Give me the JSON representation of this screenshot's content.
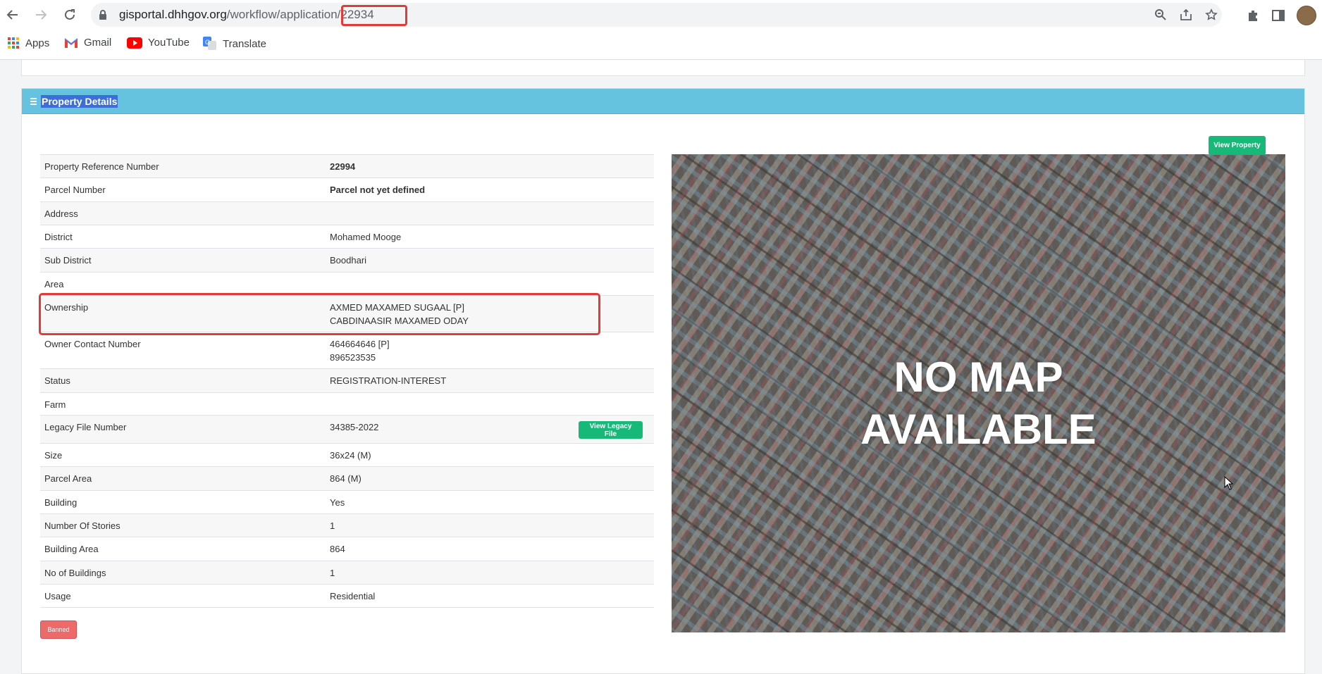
{
  "browser": {
    "url_host": "gisportal.dhhgov.org",
    "url_path": "/workflow/applicatio",
    "url_highlighted": "n/22934",
    "bookmarks": [
      {
        "label": "Apps",
        "icon": "apps-grid-icon"
      },
      {
        "label": "Gmail",
        "icon": "gmail-icon"
      },
      {
        "label": "YouTube",
        "icon": "youtube-icon"
      },
      {
        "label": "Translate",
        "icon": "translate-icon"
      }
    ]
  },
  "panel": {
    "title": "Property Details",
    "view_property_label": "View Property",
    "view_legacy_label": "View Legacy File",
    "banned_label": "Banned",
    "map_text_line1": "NO MAP",
    "map_text_line2": "AVAILABLE"
  },
  "details": [
    {
      "label": "Property Reference Number",
      "value": "22994"
    },
    {
      "label": "Parcel Number",
      "value": "Parcel not yet defined"
    },
    {
      "label": "Address",
      "value": ""
    },
    {
      "label": "District",
      "value": "Mohamed Mooge"
    },
    {
      "label": "Sub District",
      "value": "Boodhari"
    },
    {
      "label": "Area",
      "value": ""
    },
    {
      "label": "Ownership",
      "value": "AXMED MAXAMED SUGAAL [P]",
      "value2": "CABDINAASIR MAXAMED ODAY"
    },
    {
      "label": "Owner Contact Number",
      "value": "464664646 [P]",
      "value2": "896523535"
    },
    {
      "label": "Status",
      "value": "REGISTRATION-INTEREST"
    },
    {
      "label": "Farm",
      "value": ""
    },
    {
      "label": "Legacy File Number",
      "value": "34385-2022"
    },
    {
      "label": "Size",
      "value": "36x24 (M)"
    },
    {
      "label": "Parcel Area",
      "value": "864 (M)"
    },
    {
      "label": "Building",
      "value": "Yes"
    },
    {
      "label": "Number Of Stories",
      "value": "1"
    },
    {
      "label": "Building Area",
      "value": "864"
    },
    {
      "label": "No of Buildings",
      "value": "1"
    },
    {
      "label": "Usage",
      "value": "Residential"
    }
  ]
}
